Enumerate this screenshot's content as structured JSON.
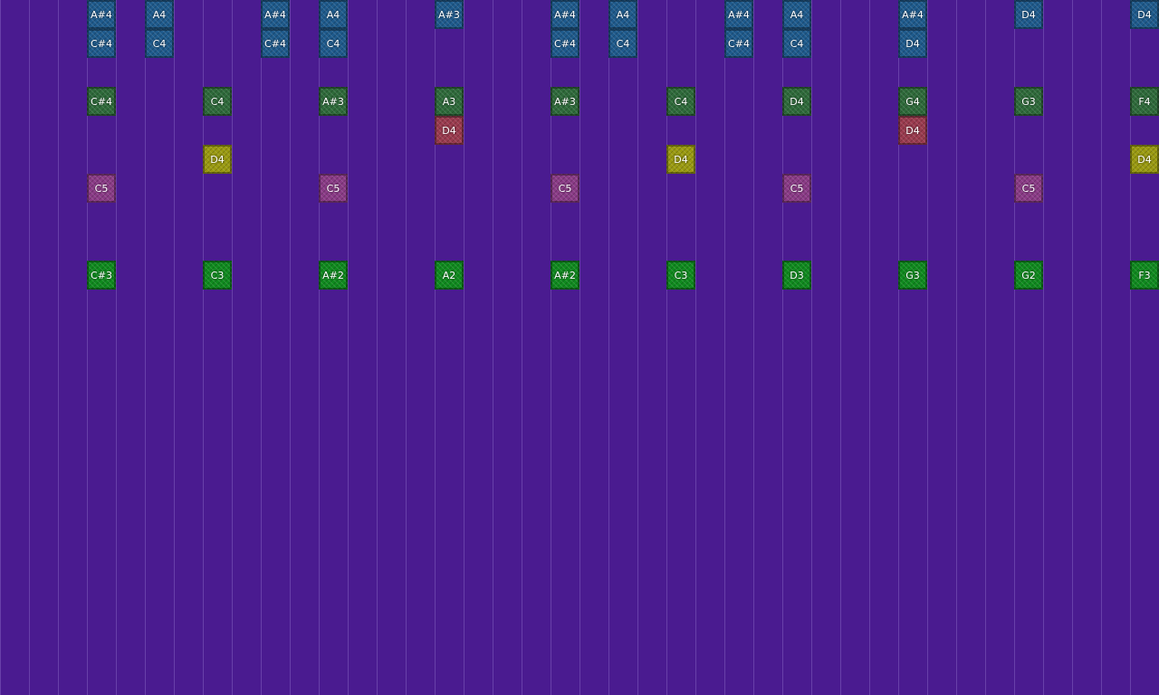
{
  "tracks": [
    {
      "key": "track-blue",
      "color": "#1e5a8c"
    },
    {
      "key": "track-green-dark",
      "color": "#2e6a3a"
    },
    {
      "key": "track-red",
      "color": "#9a3a4e"
    },
    {
      "key": "track-yellow",
      "color": "#9a9a10"
    },
    {
      "key": "track-pink",
      "color": "#8a3a86"
    },
    {
      "key": "track-green",
      "color": "#0f8a1e"
    }
  ],
  "notes": [
    {
      "col": 3,
      "row": 0,
      "track": 0,
      "label": "A#4"
    },
    {
      "col": 5,
      "row": 0,
      "track": 0,
      "label": "A4"
    },
    {
      "col": 9,
      "row": 0,
      "track": 0,
      "label": "A#4"
    },
    {
      "col": 11,
      "row": 0,
      "track": 0,
      "label": "A4"
    },
    {
      "col": 15,
      "row": 0,
      "track": 0,
      "label": "A#3"
    },
    {
      "col": 19,
      "row": 0,
      "track": 0,
      "label": "A#4"
    },
    {
      "col": 21,
      "row": 0,
      "track": 0,
      "label": "A4"
    },
    {
      "col": 25,
      "row": 0,
      "track": 0,
      "label": "A#4"
    },
    {
      "col": 27,
      "row": 0,
      "track": 0,
      "label": "A4"
    },
    {
      "col": 31,
      "row": 0,
      "track": 0,
      "label": "A#4"
    },
    {
      "col": 35,
      "row": 0,
      "track": 0,
      "label": "D4"
    },
    {
      "col": 39,
      "row": 0,
      "track": 0,
      "label": "D4"
    },
    {
      "col": 3,
      "row": 1,
      "track": 0,
      "label": "C#4"
    },
    {
      "col": 5,
      "row": 1,
      "track": 0,
      "label": "C4"
    },
    {
      "col": 9,
      "row": 1,
      "track": 0,
      "label": "C#4"
    },
    {
      "col": 11,
      "row": 1,
      "track": 0,
      "label": "C4"
    },
    {
      "col": 19,
      "row": 1,
      "track": 0,
      "label": "C#4"
    },
    {
      "col": 21,
      "row": 1,
      "track": 0,
      "label": "C4"
    },
    {
      "col": 25,
      "row": 1,
      "track": 0,
      "label": "C#4"
    },
    {
      "col": 27,
      "row": 1,
      "track": 0,
      "label": "C4"
    },
    {
      "col": 31,
      "row": 1,
      "track": 0,
      "label": "D4"
    },
    {
      "col": 3,
      "row": 3,
      "track": 1,
      "label": "C#4"
    },
    {
      "col": 7,
      "row": 3,
      "track": 1,
      "label": "C4"
    },
    {
      "col": 11,
      "row": 3,
      "track": 1,
      "label": "A#3"
    },
    {
      "col": 15,
      "row": 3,
      "track": 1,
      "label": "A3"
    },
    {
      "col": 19,
      "row": 3,
      "track": 1,
      "label": "A#3"
    },
    {
      "col": 23,
      "row": 3,
      "track": 1,
      "label": "C4"
    },
    {
      "col": 27,
      "row": 3,
      "track": 1,
      "label": "D4"
    },
    {
      "col": 31,
      "row": 3,
      "track": 1,
      "label": "G4"
    },
    {
      "col": 35,
      "row": 3,
      "track": 1,
      "label": "G3"
    },
    {
      "col": 39,
      "row": 3,
      "track": 1,
      "label": "F4"
    },
    {
      "col": 15,
      "row": 4,
      "track": 2,
      "label": "D4"
    },
    {
      "col": 31,
      "row": 4,
      "track": 2,
      "label": "D4"
    },
    {
      "col": 7,
      "row": 5,
      "track": 3,
      "label": "D4"
    },
    {
      "col": 23,
      "row": 5,
      "track": 3,
      "label": "D4"
    },
    {
      "col": 39,
      "row": 5,
      "track": 3,
      "label": "D4"
    },
    {
      "col": 3,
      "row": 6,
      "track": 4,
      "label": "C5"
    },
    {
      "col": 11,
      "row": 6,
      "track": 4,
      "label": "C5"
    },
    {
      "col": 19,
      "row": 6,
      "track": 4,
      "label": "C5"
    },
    {
      "col": 27,
      "row": 6,
      "track": 4,
      "label": "C5"
    },
    {
      "col": 35,
      "row": 6,
      "track": 4,
      "label": "C5"
    },
    {
      "col": 3,
      "row": 9,
      "track": 5,
      "label": "C#3"
    },
    {
      "col": 7,
      "row": 9,
      "track": 5,
      "label": "C3"
    },
    {
      "col": 11,
      "row": 9,
      "track": 5,
      "label": "A#2"
    },
    {
      "col": 15,
      "row": 9,
      "track": 5,
      "label": "A2"
    },
    {
      "col": 19,
      "row": 9,
      "track": 5,
      "label": "A#2"
    },
    {
      "col": 23,
      "row": 9,
      "track": 5,
      "label": "C3"
    },
    {
      "col": 27,
      "row": 9,
      "track": 5,
      "label": "D3"
    },
    {
      "col": 31,
      "row": 9,
      "track": 5,
      "label": "G3"
    },
    {
      "col": 35,
      "row": 9,
      "track": 5,
      "label": "G2"
    },
    {
      "col": 39,
      "row": 9,
      "track": 5,
      "label": "F3"
    }
  ]
}
